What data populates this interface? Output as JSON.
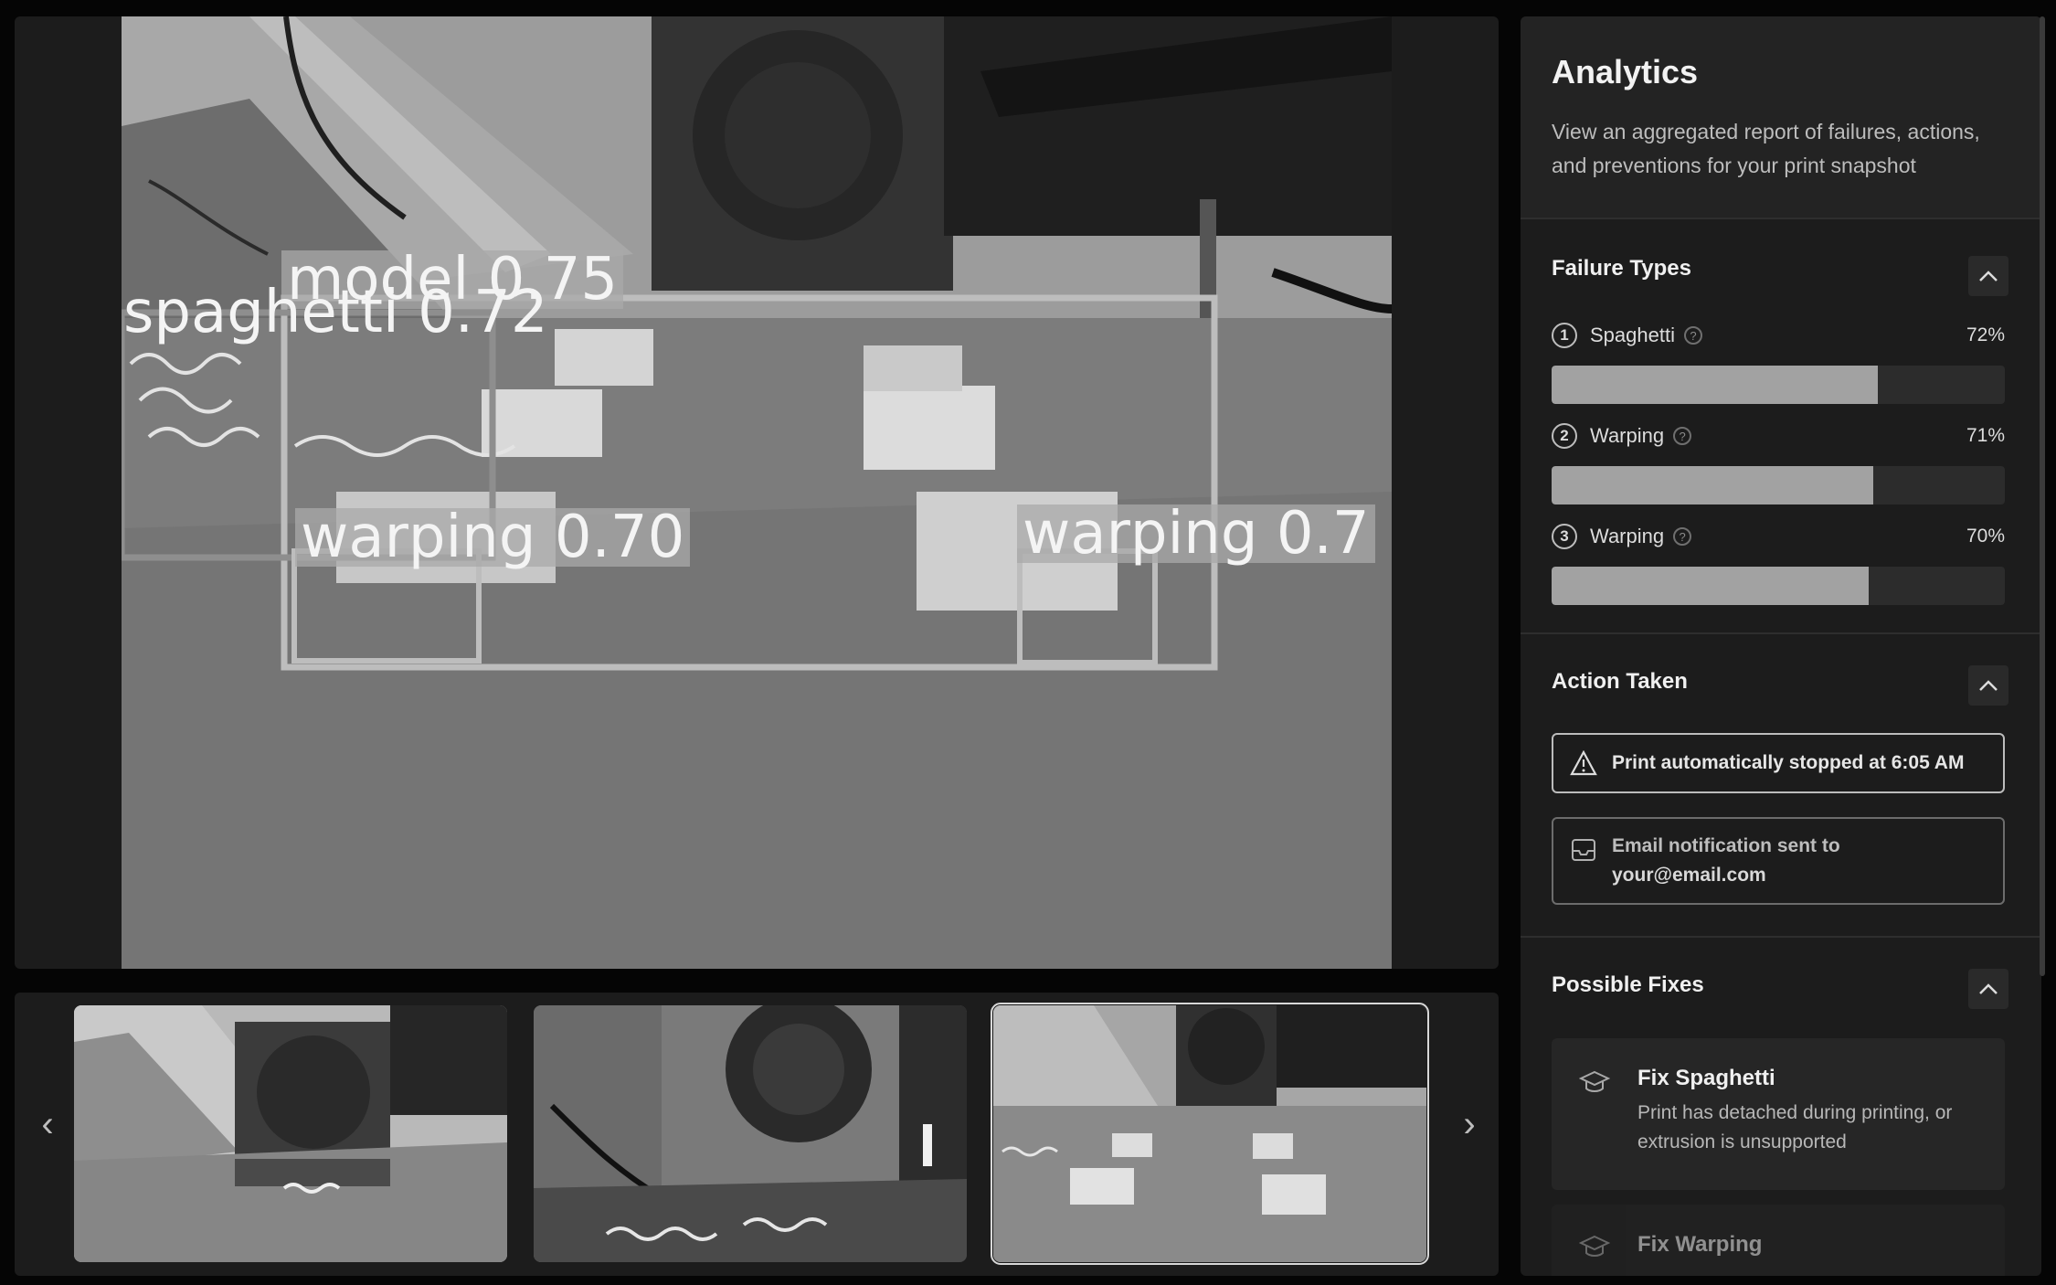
{
  "snapshot": {
    "detections": [
      {
        "label": "model 0.75"
      },
      {
        "label": "spaghetti 0.72"
      },
      {
        "label": "warping 0.70"
      },
      {
        "label": "warping 0.7"
      }
    ]
  },
  "strip": {
    "prev_icon": "chevron-left-icon",
    "next_icon": "chevron-right-icon",
    "prev_glyph": "‹",
    "next_glyph": "›"
  },
  "analytics": {
    "title": "Analytics",
    "description": "View an aggregated report of failures, actions, and preventions for your print snapshot",
    "failure_types": {
      "title": "Failure Types",
      "items": [
        {
          "rank": "1",
          "name": "Spaghetti",
          "percent_label": "72%",
          "value": 0.72
        },
        {
          "rank": "2",
          "name": "Warping",
          "percent_label": "71%",
          "value": 0.71
        },
        {
          "rank": "3",
          "name": "Warping",
          "percent_label": "70%",
          "value": 0.7
        }
      ]
    },
    "action_taken": {
      "title": "Action Taken",
      "stopped": "Print automatically stopped at 6:05 AM",
      "email_prefix": "Email notification sent to",
      "email": "your@email.com"
    },
    "possible_fixes": {
      "title": "Possible Fixes",
      "items": [
        {
          "title": "Fix Spaghetti",
          "description": "Print has detached during printing, or extrusion is unsupported"
        },
        {
          "title": "Fix Warping",
          "description": ""
        }
      ]
    }
  },
  "colors": {
    "background": "#050505",
    "panel": "#1c1c1c",
    "bar_fill": "#a2a2a2",
    "bar_track": "#2c2c2c"
  }
}
